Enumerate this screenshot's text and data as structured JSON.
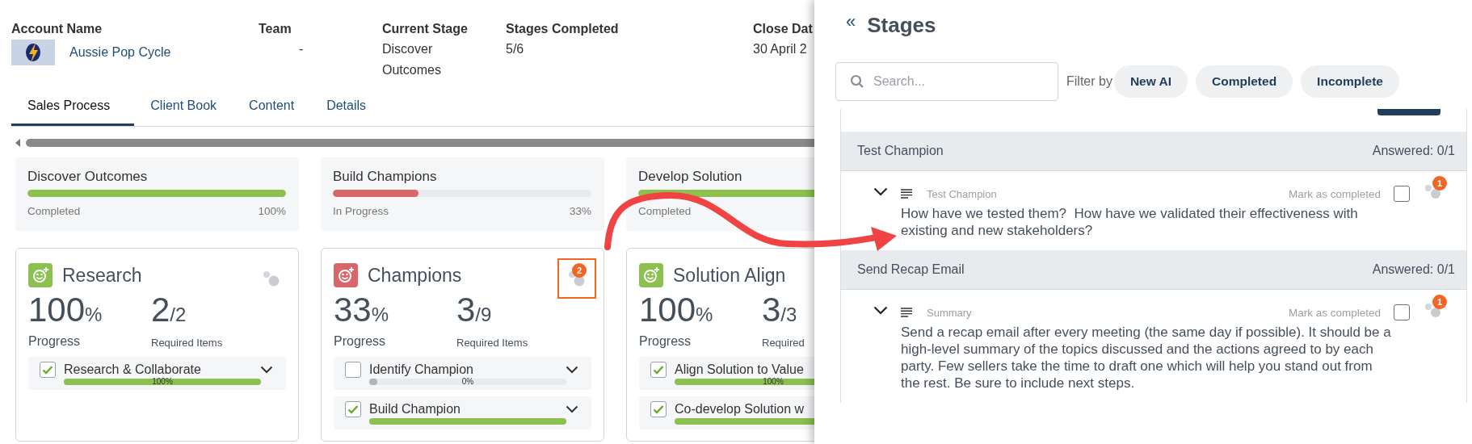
{
  "header": {
    "fields": [
      {
        "kind": "account",
        "label": "Account Name",
        "value": "Aussie Pop Cycle"
      },
      {
        "kind": "text",
        "label": "Team",
        "value": "-"
      },
      {
        "kind": "text",
        "label": "Current Stage",
        "value": "Discover Outcomes"
      },
      {
        "kind": "text",
        "label": "Stages Completed",
        "value": "5/6"
      },
      {
        "kind": "text",
        "label": "Close Dat",
        "value": "30 April 2"
      }
    ]
  },
  "tabs": [
    {
      "label": "Sales Process",
      "selected": true
    },
    {
      "label": "Client Book",
      "selected": false
    },
    {
      "label": "Content",
      "selected": false
    },
    {
      "label": "Details",
      "selected": false
    }
  ],
  "summary": [
    {
      "title": "Discover Outcomes",
      "color": "#8cc04f",
      "level": 1,
      "status_text": "Completed",
      "percent": "100%"
    },
    {
      "title": "Build Champions",
      "color": "#d9666b",
      "level": 0.33,
      "status_text": "In Progress",
      "percent": "33%"
    },
    {
      "title": "Develop Solution",
      "color": "#8cc04f",
      "level": 1,
      "status_text": "Completed"
    }
  ],
  "stages": [
    {
      "title": "Research",
      "color": "#8cc04f",
      "highlighted": false,
      "collaborators": true,
      "progress": "100",
      "progress_unit": "%",
      "done": "2",
      "total": "/2",
      "progress_label": "Progress",
      "required_label": "Required Items",
      "items": [
        {
          "label": "Research & Collaborate",
          "checked": true,
          "level": 1,
          "percent": "100%"
        }
      ]
    },
    {
      "title": "Champions",
      "color": "#d9666b",
      "highlighted": true,
      "collaborators": true,
      "badge": "2",
      "progress": "33",
      "progress_unit": "%",
      "done": "3",
      "total": "/9",
      "progress_label": "Progress",
      "required_label": "Required Items",
      "items": [
        {
          "label": "Identify Champion",
          "checked": false,
          "level": 0,
          "percent": "0%"
        },
        {
          "label": "Build Champion",
          "checked": true,
          "level": 1
        }
      ]
    },
    {
      "title": "Solution Align",
      "color": "#8cc04f",
      "highlighted": false,
      "collaborators": false,
      "progress": "100",
      "progress_unit": "%",
      "done": "3",
      "total": "/3",
      "progress_label": "Progress",
      "required_label": "Required",
      "items": [
        {
          "label": "Align Solution to Value",
          "checked": true,
          "level": 1,
          "percent": "100%"
        },
        {
          "label": "Co-develop Solution w",
          "checked": true,
          "level": 1
        }
      ]
    }
  ],
  "panel": {
    "collapse": "«",
    "title": "Stages",
    "search": {
      "placeholder": "Search..."
    },
    "filter_label": "Filter by",
    "filters": [
      "New AI",
      "Completed",
      "Incomplete"
    ],
    "groups": [
      {
        "title": "Test Champion",
        "answered": "Answered: 0/1",
        "items": [
          {
            "type_label": "Test Champion",
            "mark_label": "Mark as completed",
            "checked": false,
            "badge": "1",
            "text": "How have we tested them?  How have we validated their effectiveness with existing and new stakeholders?"
          }
        ]
      },
      {
        "title": "Send Recap Email",
        "answered": "Answered: 0/1",
        "items": [
          {
            "type_label": "Summary",
            "mark_label": "Mark as completed",
            "checked": false,
            "badge": "1",
            "text": "Send a recap email after every meeting (the same day if possible). It should be a high-level summary of the topics discussed and the actions agreed to by each party. Few sellers take the time to draft one which will help you stand out from the rest. Be sure to include next steps."
          }
        ]
      }
    ]
  }
}
